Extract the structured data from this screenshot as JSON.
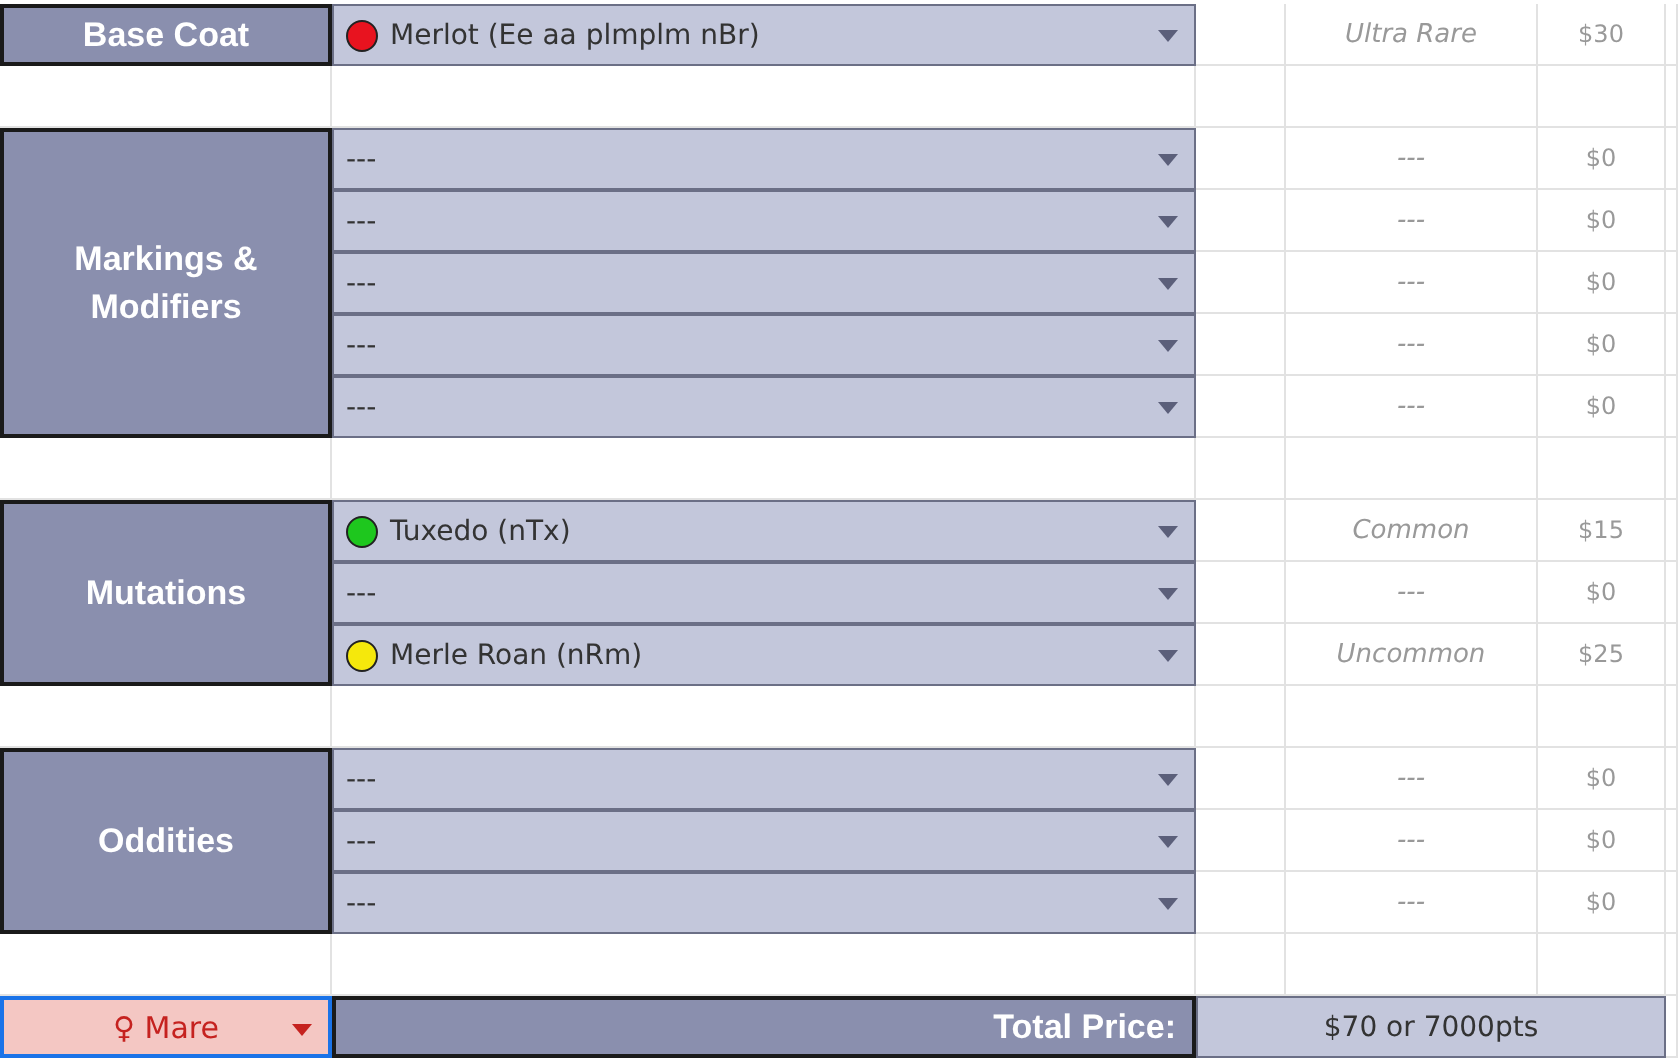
{
  "sections": [
    {
      "label": "Base Coat",
      "traits": [
        {
          "name": "Merlot (Ee aa plmplm nBr)",
          "color": "#e8131f",
          "rarity": "Ultra Rare",
          "price": "$30"
        }
      ]
    },
    {
      "label": "Markings & Modifiers",
      "traits": [
        {
          "name": "---",
          "rarity": "---",
          "price": "$0"
        },
        {
          "name": "---",
          "rarity": "---",
          "price": "$0"
        },
        {
          "name": "---",
          "rarity": "---",
          "price": "$0"
        },
        {
          "name": "---",
          "rarity": "---",
          "price": "$0"
        },
        {
          "name": "---",
          "rarity": "---",
          "price": "$0"
        }
      ]
    },
    {
      "label": "Mutations",
      "traits": [
        {
          "name": "Tuxedo (nTx)",
          "color": "#1ec71e",
          "rarity": "Common",
          "price": "$15"
        },
        {
          "name": "---",
          "rarity": "---",
          "price": "$0"
        },
        {
          "name": "Merle Roan (nRm)",
          "color": "#f5e80c",
          "rarity": "Uncommon",
          "price": "$25"
        }
      ]
    },
    {
      "label": "Oddities",
      "traits": [
        {
          "name": "---",
          "rarity": "---",
          "price": "$0"
        },
        {
          "name": "---",
          "rarity": "---",
          "price": "$0"
        },
        {
          "name": "---",
          "rarity": "---",
          "price": "$0"
        }
      ]
    }
  ],
  "sex": {
    "label": "♀ Mare",
    "selected": true
  },
  "total": {
    "label": "Total Price:",
    "value": "$70 or 7000pts"
  }
}
